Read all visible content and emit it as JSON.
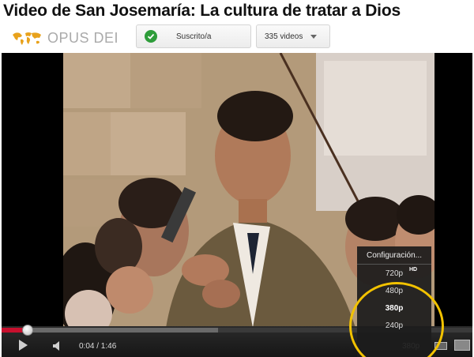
{
  "video_title": "Video de San Josemaría: La cultura de tratar a Dios",
  "channel": {
    "logo_text": "OPUS DEI",
    "subscribe_label": "Suscrito/a",
    "videos_label": "335 videos"
  },
  "player": {
    "time_display": "0:04 / 1:46",
    "quality_label": "380p",
    "progress": {
      "played_fraction": 0.055,
      "buffered_fraction": 0.46
    }
  },
  "quality_menu": {
    "header": "Configuración...",
    "options": [
      {
        "label": "720p",
        "hd_badge": "HD"
      },
      {
        "label": "480p"
      },
      {
        "label": "380p"
      },
      {
        "label": "240p"
      }
    ],
    "selected": "380p"
  },
  "colors": {
    "progress_played": "#c8102e",
    "subscribed_check": "#2e9d3a",
    "annotation_circle": "#f2c200"
  }
}
